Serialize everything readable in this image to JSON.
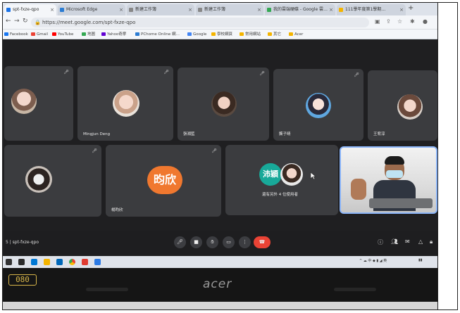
{
  "browser": {
    "tabs": [
      {
        "label": "spt-fxze-qpo",
        "color": "#1a73e8",
        "active": true
      },
      {
        "label": "Microsoft Edge",
        "color": "#2b7cd3",
        "active": false
      },
      {
        "label": "新建工作簿",
        "color": "#888888",
        "active": false
      },
      {
        "label": "新建工作簿",
        "color": "#888888",
        "active": false
      },
      {
        "label": "我的雲端硬碟 - Google 雲…",
        "color": "#34a853",
        "active": false
      },
      {
        "label": "111學年度第1學期…",
        "color": "#f4b400",
        "active": false
      }
    ],
    "new_tab_symbol": "+",
    "url": "https://meet.google.com/spt-fxze-qpo",
    "bookmarks": [
      {
        "label": "Facebook",
        "color": "#1877f2"
      },
      {
        "label": "Gmail",
        "color": "#ea4335"
      },
      {
        "label": "YouTube",
        "color": "#ff0000"
      },
      {
        "label": "地圖",
        "color": "#34a853"
      },
      {
        "label": "Yahoo奇摩",
        "color": "#6001d2"
      },
      {
        "label": "PChome Online 網…",
        "color": "#2b7cd3"
      },
      {
        "label": "Google",
        "color": "#4285f4"
      },
      {
        "label": "學校網頁",
        "color": "#f4b400"
      },
      {
        "label": "常用網站",
        "color": "#f4b400"
      },
      {
        "label": "其它",
        "color": "#f4b400"
      },
      {
        "label": "Acer",
        "color": "#f4b400"
      }
    ]
  },
  "meet": {
    "participants": [
      {
        "name": "",
        "avatar": "photo"
      },
      {
        "name": "Mingjun Deng",
        "avatar": "photo"
      },
      {
        "name": "張湘藍",
        "avatar": "photo"
      },
      {
        "name": "龔子晴",
        "avatar": "photo"
      },
      {
        "name": "王宥淳",
        "avatar": "photo"
      },
      {
        "name": "",
        "avatar": "photo"
      },
      {
        "name": "楊昀欣",
        "avatar_text": "昀欣",
        "avatar_color": "#f0782f"
      },
      {
        "name": "還有另外 4 位使用者",
        "avatar_text": "沛穎",
        "avatar_color": "#18a999"
      },
      {
        "name": "",
        "avatar": "video"
      }
    ],
    "meeting_code": "spt-fxze-qpo",
    "meeting_code_prefix": "5  |"
  },
  "colors": {
    "end_call": "#ea4335",
    "active_tile_border": "#8ab4f8"
  },
  "laptop": {
    "brand": "acer",
    "sticker": "080"
  }
}
